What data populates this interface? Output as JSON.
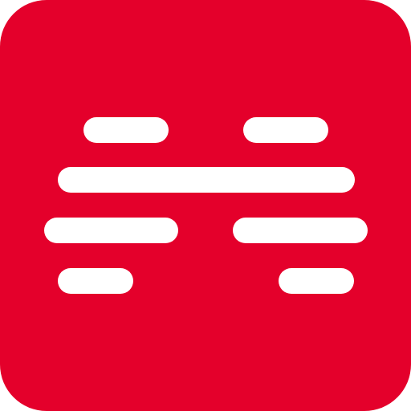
{
  "icon": {
    "name": "app-logo-icon",
    "background_color": "#e4002b",
    "bar_color": "#ffffff",
    "bars": [
      {
        "name": "logo-bar-top-left"
      },
      {
        "name": "logo-bar-top-right"
      },
      {
        "name": "logo-bar-middle-wide"
      },
      {
        "name": "logo-bar-lower-left"
      },
      {
        "name": "logo-bar-lower-right"
      },
      {
        "name": "logo-bar-bottom-left"
      },
      {
        "name": "logo-bar-bottom-right"
      }
    ]
  }
}
